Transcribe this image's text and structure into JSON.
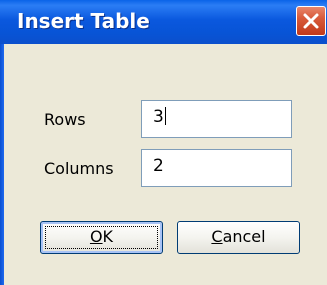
{
  "window": {
    "title": "Insert Table"
  },
  "form": {
    "rows_label": "Rows",
    "rows_value": "3",
    "columns_label": "Columns",
    "columns_value": "2"
  },
  "buttons": {
    "ok": {
      "mnemonic": "O",
      "rest": "K"
    },
    "cancel": {
      "mnemonic": "C",
      "rest": "ancel"
    }
  },
  "colors": {
    "titlebar": "#0a58de",
    "dialog_bg": "#ece9d8",
    "close": "#d85a3b"
  },
  "icons": [
    "close-icon"
  ]
}
